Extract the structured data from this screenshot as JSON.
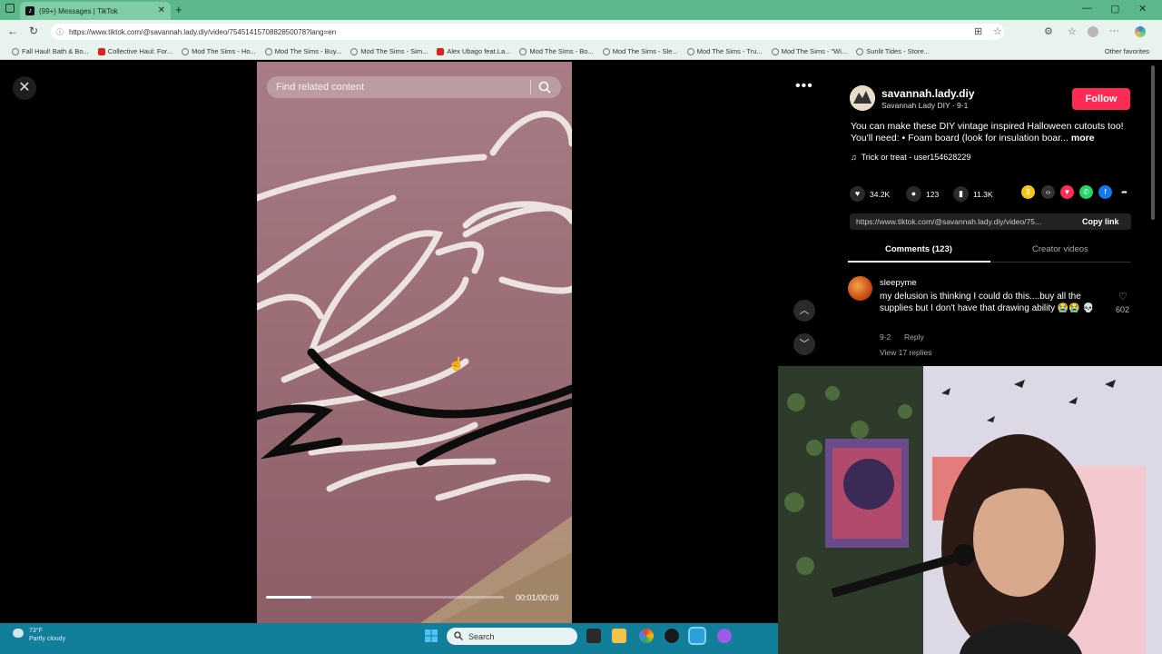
{
  "browser": {
    "tab_title": "(99+) Messages | TikTok",
    "new_tab": "+",
    "url": "https://www.tiktok.com/@savannah.lady.diy/video/7545141570882850078?lang=en",
    "bookmarks": [
      {
        "label": "Fall Haul! Bath & Bo...",
        "icon": "globe-icon"
      },
      {
        "label": "Collective Haul: For...",
        "icon": "youtube-icon"
      },
      {
        "label": "Mod The Sims - Ho...",
        "icon": "globe-icon"
      },
      {
        "label": "Mod The Sims - Buy...",
        "icon": "globe-icon"
      },
      {
        "label": "Mod The Sims - Sim...",
        "icon": "globe-icon"
      },
      {
        "label": "Alex Ubago feat.La...",
        "icon": "youtube-icon"
      },
      {
        "label": "Mod The Sims - Bo...",
        "icon": "globe-icon"
      },
      {
        "label": "Mod The Sims - Sle...",
        "icon": "globe-icon"
      },
      {
        "label": "Mod The Sims - Tru...",
        "icon": "globe-icon"
      },
      {
        "label": "Mod The Sims - \"Wi...",
        "icon": "globe-icon"
      },
      {
        "label": "Sunlit Tides - Store...",
        "icon": "globe-icon"
      }
    ],
    "other_favorites": "Other favorites"
  },
  "video": {
    "search_placeholder": "Find related content",
    "time": "00:01/00:09",
    "progress": 0.19
  },
  "post": {
    "username": "savannah.lady.diy",
    "subline": "Savannah Lady DIY · 9-1",
    "follow_label": "Follow",
    "description": "You can make these DIY vintage inspired Halloween cutouts too! You'll need: • Foam board (look for insulation boar...",
    "more_label": "more",
    "music": "Trick or treat - user154628229",
    "likes": "34.2K",
    "comments": "123",
    "saves": "11.3K",
    "link": "https://www.tiktok.com/@savannah.lady.diy/video/75...",
    "copy_link": "Copy link",
    "tab_comments": "Comments (123)",
    "tab_creator": "Creator videos"
  },
  "comment": {
    "user": "sleepyme",
    "text": "my delusion is thinking I could do this....buy all the supplies but I don't have that drawing ability 😭😭 💀",
    "date": "9-2",
    "reply": "Reply",
    "view_replies": "View 17 replies",
    "likes": "602"
  },
  "taskbar": {
    "weather_temp": "73°F",
    "weather_desc": "Partly cloudy",
    "search_label": "Search"
  },
  "colors": {
    "tiktok_red": "#fe2c55",
    "browser_green": "#5cb88a",
    "taskbar_teal": "#127f9a"
  }
}
